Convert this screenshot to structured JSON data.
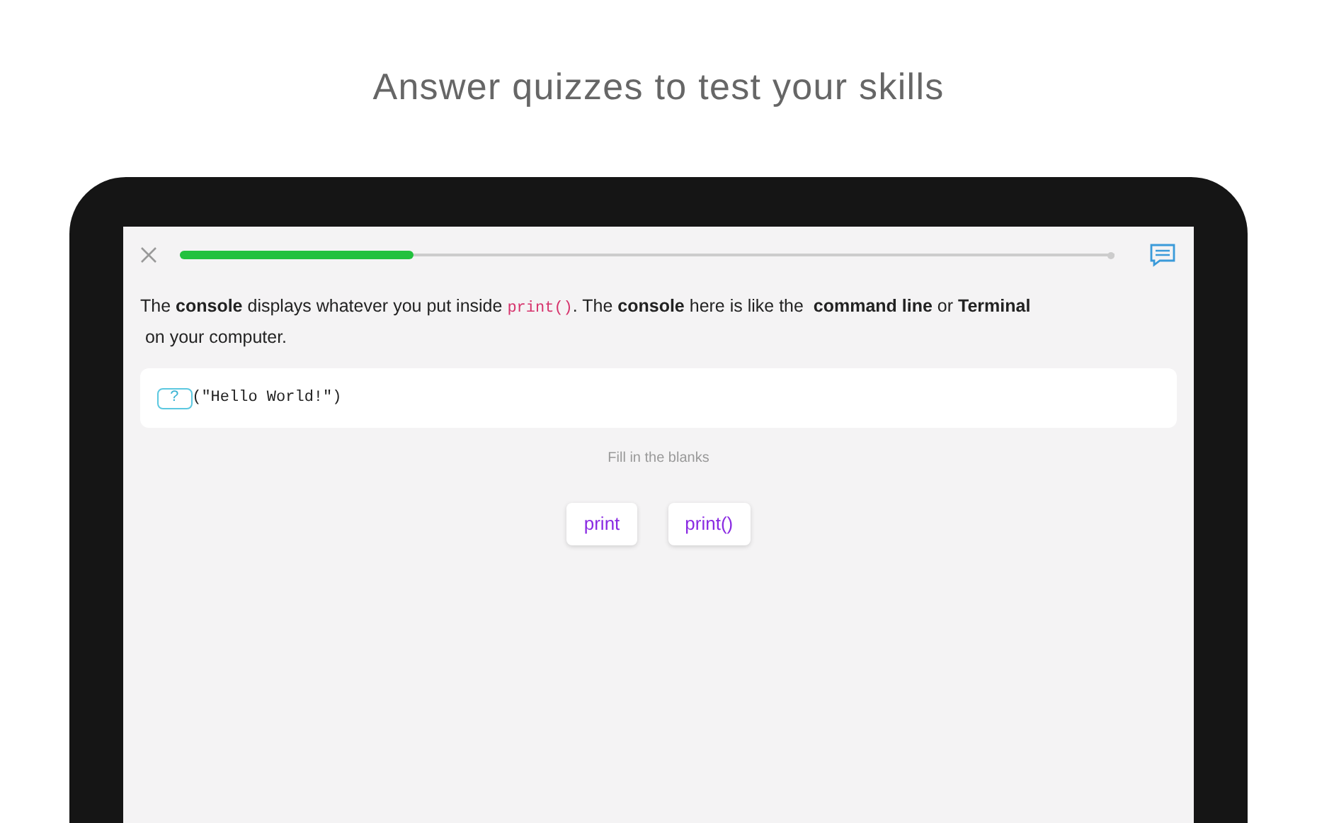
{
  "headline": "Answer quizzes to test your skills",
  "progress": {
    "level": 0.25
  },
  "instruction": [
    {
      "kind": "text",
      "text": "The "
    },
    {
      "kind": "bold",
      "text": "console"
    },
    {
      "kind": "text",
      "text": " displays whatever you put inside "
    },
    {
      "kind": "code",
      "text": "print()"
    },
    {
      "kind": "text",
      "text": ". The "
    },
    {
      "kind": "bold",
      "text": "console"
    },
    {
      "kind": "text",
      "text": " here is like the  "
    },
    {
      "kind": "bold",
      "text": "command line"
    },
    {
      "kind": "text",
      "text": " or "
    },
    {
      "kind": "bold",
      "text": "Terminal"
    },
    {
      "kind": "text",
      "text": " on your computer."
    }
  ],
  "code": {
    "blank": "?",
    "rest": "(\"Hello World!\")"
  },
  "hint": "Fill in the blanks",
  "options": [
    "print",
    "print()"
  ]
}
